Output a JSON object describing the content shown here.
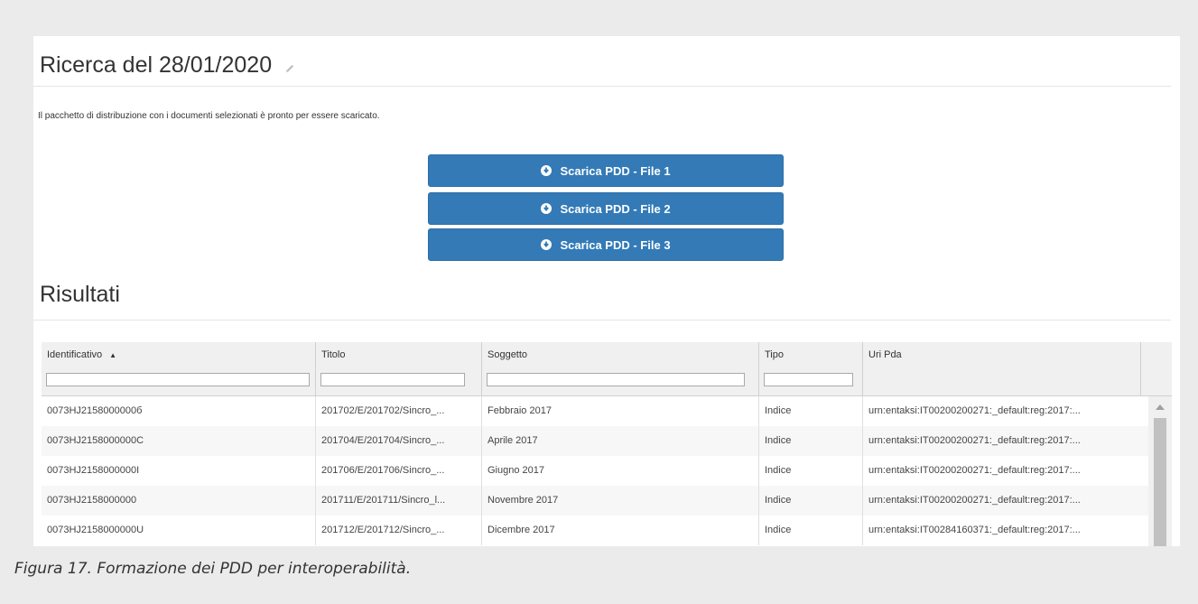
{
  "page": {
    "title": "Ricerca del 28/01/2020",
    "notice": "Il pacchetto di distribuzione con i documenti selezionati è pronto per essere scaricato.",
    "results_title": "Risultati"
  },
  "buttons": [
    {
      "label": "Scarica PDD - File 1",
      "icon": "download-circle-icon"
    },
    {
      "label": "Scarica PDD - File 2",
      "icon": "download-circle-icon"
    },
    {
      "label": "Scarica PDD - File 3",
      "icon": "download-circle-icon"
    }
  ],
  "table": {
    "columns": [
      {
        "label": "Identificativo",
        "sorted": "ascending"
      },
      {
        "label": "Titolo"
      },
      {
        "label": "Soggetto"
      },
      {
        "label": "Tipo"
      },
      {
        "label": "Uri Pda"
      }
    ],
    "rows": [
      [
        "0073HJ2158000000б",
        "201702/E/201702/Sincro_...",
        "Febbraio 2017",
        "Indice",
        "urn:entaksi:IT00200200271:_default:reg:2017:..."
      ],
      [
        "0073HJ2158000000C",
        "201704/E/201704/Sincro_...",
        "Aprile 2017",
        "Indice",
        "urn:entaksi:IT00200200271:_default:reg:2017:..."
      ],
      [
        "0073HJ2158000000I",
        "201706/E/201706/Sincro_...",
        "Giugno 2017",
        "Indice",
        "urn:entaksi:IT00200200271:_default:reg:2017:..."
      ],
      [
        "0073HJ2158000000",
        "201711/E/201711/Sincro_l...",
        "Novembre 2017",
        "Indice",
        "urn:entaksi:IT00200200271:_default:reg:2017:..."
      ],
      [
        "0073HJ2158000000U",
        "201712/E/201712/Sincro_...",
        "Dicembre 2017",
        "Indice",
        "urn:entaksi:IT00284160371:_default:reg:2017:..."
      ]
    ]
  },
  "caption": "Figura 17. Formazione dei PDD per interoperabilità.",
  "colors": {
    "primary_button": "#337ab7",
    "background": "#ebebeb"
  }
}
